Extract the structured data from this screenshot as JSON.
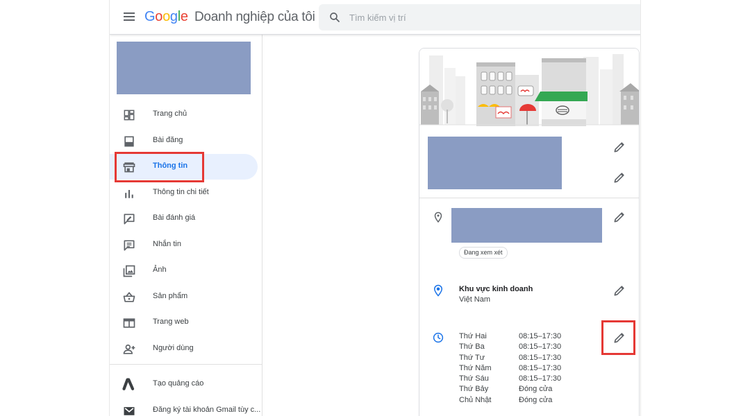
{
  "app": {
    "logo_letters": [
      "G",
      "o",
      "o",
      "g",
      "l",
      "e"
    ],
    "product_name": "Doanh nghiệp của tôi"
  },
  "search": {
    "placeholder": "Tìm kiếm vị trí",
    "value": ""
  },
  "sidebar": {
    "items": [
      {
        "label": "Trang chủ",
        "icon": "dashboard-icon",
        "active": false
      },
      {
        "label": "Bài đăng",
        "icon": "post-icon",
        "active": false
      },
      {
        "label": "Thông tin",
        "icon": "storefront-icon",
        "active": true
      },
      {
        "label": "Thông tin chi tiết",
        "icon": "bar-chart-icon",
        "active": false
      },
      {
        "label": "Bài đánh giá",
        "icon": "rate-review-icon",
        "active": false
      },
      {
        "label": "Nhắn tin",
        "icon": "message-icon",
        "active": false
      },
      {
        "label": "Ảnh",
        "icon": "photo-icon",
        "active": false
      },
      {
        "label": "Sản phẩm",
        "icon": "basket-icon",
        "active": false
      },
      {
        "label": "Trang web",
        "icon": "web-icon",
        "active": false
      },
      {
        "label": "Người dùng",
        "icon": "person-add-icon",
        "active": false
      },
      {
        "label": "Tạo quảng cáo",
        "icon": "google-ads-icon",
        "active": false
      },
      {
        "label": "Đăng ký tài khoản Gmail tùy c...",
        "icon": "gmail-icon",
        "active": false
      }
    ]
  },
  "info": {
    "address_status": "Đang xem xét",
    "service_area_title": "Khu vực kinh doanh",
    "service_area_value": "Việt Nam",
    "hours": [
      {
        "day": "Thứ Hai",
        "time": "08:15–17:30"
      },
      {
        "day": "Thứ Ba",
        "time": "08:15–17:30"
      },
      {
        "day": "Thứ Tư",
        "time": "08:15–17:30"
      },
      {
        "day": "Thứ Năm",
        "time": "08:15–17:30"
      },
      {
        "day": "Thứ Sáu",
        "time": "08:15–17:30"
      },
      {
        "day": "Thứ Bảy",
        "time": "Đóng cửa"
      },
      {
        "day": "Chủ Nhật",
        "time": "Đóng cửa"
      }
    ]
  },
  "colors": {
    "accent": "#1a73e8",
    "highlight_border": "#e53935",
    "redaction": "#8a9cc3"
  }
}
